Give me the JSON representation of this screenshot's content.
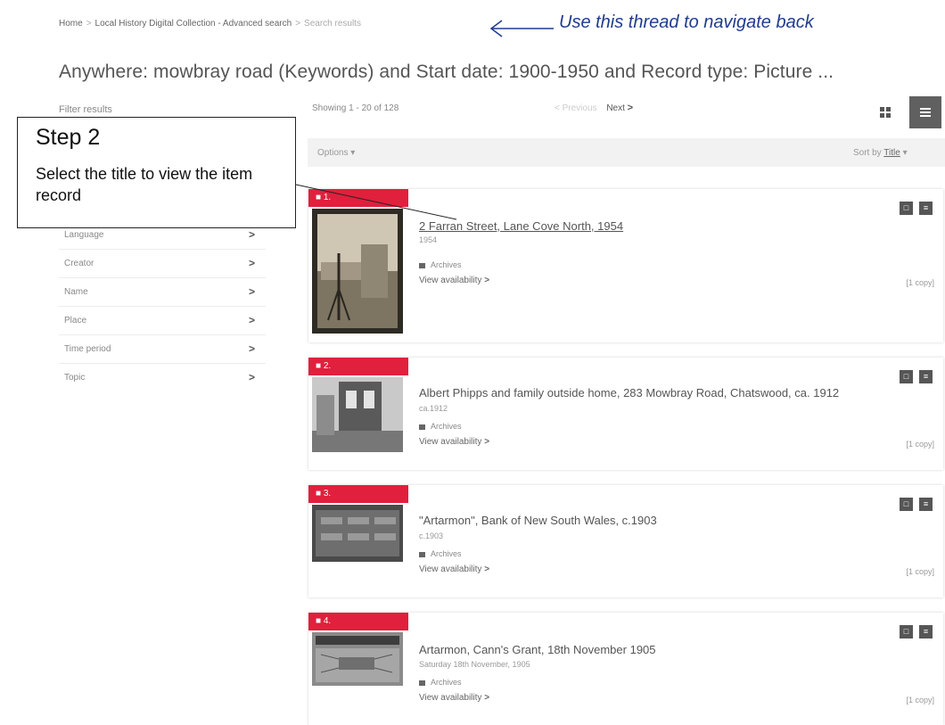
{
  "breadcrumb": {
    "home": "Home",
    "collection": "Local History Digital Collection - Advanced search",
    "current": "Search results"
  },
  "annotation_top": "Use this thread to navigate back",
  "page_title": "Anywhere: mowbray road (Keywords) and Start date: 1900-1950 and Record type: Picture ...",
  "filter_header": "Filter results",
  "facets": [
    "Language",
    "Creator",
    "Name",
    "Place",
    "Time period",
    "Topic"
  ],
  "showing": "Showing 1 - 20 of 128",
  "pager": {
    "previous": "Previous",
    "next": "Next"
  },
  "toolbar": {
    "options": "Options",
    "sort_prefix": "Sort by",
    "sort_value": "Title"
  },
  "results": [
    {
      "index": "1.",
      "title": "2 Farran Street, Lane Cove North, 1954",
      "date": "1954",
      "format": "Archives",
      "availability": "View availability",
      "copies": "[1 copy]"
    },
    {
      "index": "2.",
      "title": "Albert Phipps and family outside home, 283 Mowbray Road, Chatswood, ca. 1912",
      "date": "ca.1912",
      "format": "Archives",
      "availability": "View availability",
      "copies": "[1 copy]"
    },
    {
      "index": "3.",
      "title": "\"Artarmon\", Bank of New South Wales, c.1903",
      "date": "c.1903",
      "format": "Archives",
      "availability": "View availability",
      "copies": "[1 copy]"
    },
    {
      "index": "4.",
      "title": "Artarmon, Cann's Grant, 18th November 1905",
      "date": "Saturday 18th November, 1905",
      "format": "Archives",
      "availability": "View availability",
      "copies": "[1 copy]"
    }
  ],
  "callout": {
    "title": "Step 2",
    "description": "Select the title to view the item record"
  },
  "colors": {
    "badge": "#e0203d",
    "annotation": "#1f3c8f",
    "toolbar_bg": "#f2f2f2",
    "active_view": "#606060"
  }
}
